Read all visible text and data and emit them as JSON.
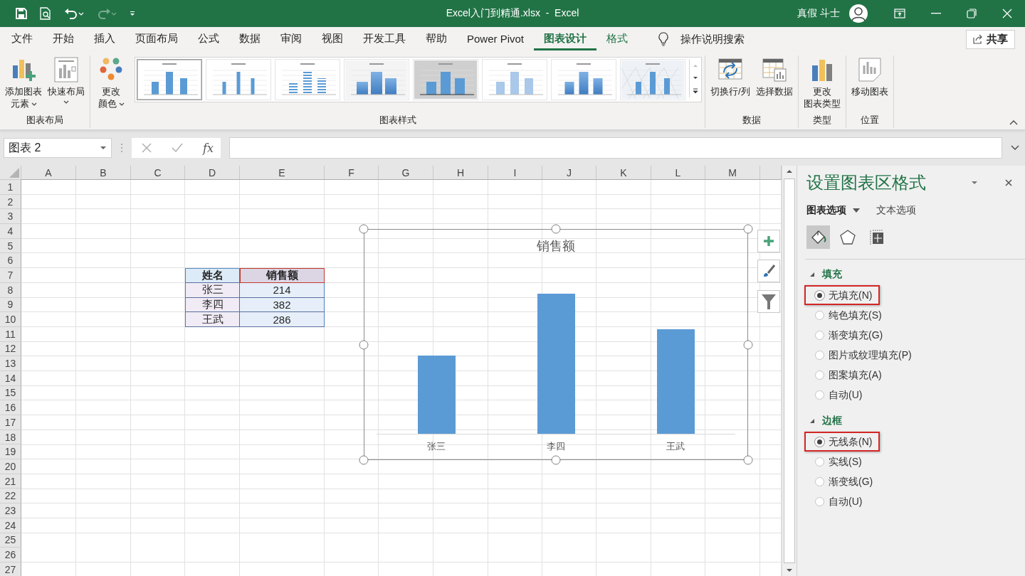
{
  "window": {
    "title": "Excel入门到精通.xlsx  -  Excel",
    "user": "真假 斗士"
  },
  "quick_access": [
    {
      "kind": "save",
      "disabled": false
    },
    {
      "kind": "preview",
      "disabled": false
    },
    {
      "kind": "undo",
      "disabled": false
    },
    {
      "kind": "redo",
      "disabled": true
    },
    {
      "kind": "customize",
      "disabled": false
    }
  ],
  "tabs": [
    {
      "label": "文件",
      "selected": false,
      "contextual": false
    },
    {
      "label": "开始",
      "selected": false,
      "contextual": false
    },
    {
      "label": "插入",
      "selected": false,
      "contextual": false
    },
    {
      "label": "页面布局",
      "selected": false,
      "contextual": false
    },
    {
      "label": "公式",
      "selected": false,
      "contextual": false
    },
    {
      "label": "数据",
      "selected": false,
      "contextual": false
    },
    {
      "label": "审阅",
      "selected": false,
      "contextual": false
    },
    {
      "label": "视图",
      "selected": false,
      "contextual": false
    },
    {
      "label": "开发工具",
      "selected": false,
      "contextual": false
    },
    {
      "label": "帮助",
      "selected": false,
      "contextual": false
    },
    {
      "label": "Power Pivot",
      "selected": false,
      "contextual": false
    },
    {
      "label": "图表设计",
      "selected": true,
      "contextual": true
    },
    {
      "label": "格式",
      "selected": false,
      "contextual": true
    }
  ],
  "tell_me": "操作说明搜索",
  "share": "共享",
  "ribbon": {
    "groups": [
      {
        "label": "图表布局",
        "buttons": [
          {
            "label": "添加图表元素",
            "kind": "add-element",
            "dropdown": true
          },
          {
            "label": "快速布局",
            "kind": "quick-layout",
            "dropdown": true
          }
        ]
      },
      {
        "label": "图表样式",
        "buttons": [
          {
            "label": "更改颜色",
            "kind": "colors",
            "dropdown": true
          }
        ],
        "styles": [
          {
            "kind": "plain",
            "selected": true
          },
          {
            "kind": "thin",
            "selected": false
          },
          {
            "kind": "striped",
            "selected": false
          },
          {
            "kind": "gradient",
            "selected": false
          },
          {
            "kind": "dark",
            "selected": false
          },
          {
            "kind": "light",
            "selected": false
          },
          {
            "kind": "shaded",
            "selected": false
          },
          {
            "kind": "hatched",
            "selected": false
          }
        ]
      },
      {
        "label": "数据",
        "buttons": [
          {
            "label": "切换行/列",
            "kind": "switch",
            "dropdown": false
          },
          {
            "label": "选择数据",
            "kind": "select-data",
            "dropdown": false
          }
        ]
      },
      {
        "label": "类型",
        "buttons": [
          {
            "label": "更改图表类型",
            "kind": "change-type",
            "dropdown": false
          }
        ]
      },
      {
        "label": "位置",
        "buttons": [
          {
            "label": "移动图表",
            "kind": "move",
            "dropdown": false
          }
        ]
      }
    ]
  },
  "formula_bar": {
    "name_box": "图表 2",
    "function_label": "fx"
  },
  "sheet": {
    "columns": [
      "A",
      "B",
      "C",
      "D",
      "E",
      "F",
      "G",
      "H",
      "I",
      "J",
      "K",
      "L",
      "M"
    ],
    "rows": [
      "1",
      "2",
      "3",
      "4",
      "5",
      "6",
      "7",
      "8",
      "9",
      "10",
      "11",
      "12",
      "13",
      "14",
      "15",
      "16",
      "17",
      "18",
      "19",
      "20",
      "21",
      "22",
      "23",
      "24",
      "25",
      "26",
      "27"
    ],
    "table": {
      "header": [
        "姓名",
        "销售额"
      ],
      "rows": [
        [
          "张三",
          "214"
        ],
        [
          "李四",
          "382"
        ],
        [
          "王武",
          "286"
        ]
      ]
    }
  },
  "chart": {
    "title": "销售额",
    "categories": [
      "张三",
      "李四",
      "王武"
    ]
  },
  "panel": {
    "title": "设置图表区格式",
    "tabs": [
      {
        "label": "图表选项",
        "selected": true,
        "dropdown": true
      },
      {
        "label": "文本选项",
        "selected": false,
        "dropdown": false
      }
    ],
    "icon_tabs": [
      {
        "kind": "fill",
        "selected": true
      },
      {
        "kind": "effects",
        "selected": false
      },
      {
        "kind": "size",
        "selected": false
      }
    ],
    "sections": [
      {
        "title": "填充",
        "expanded": true,
        "options": [
          {
            "label": "无填充(N)",
            "selected": true,
            "annotated": true
          },
          {
            "label": "纯色填充(S)",
            "selected": false,
            "annotated": false
          },
          {
            "label": "渐变填充(G)",
            "selected": false,
            "annotated": false
          },
          {
            "label": "图片或纹理填充(P)",
            "selected": false,
            "annotated": false
          },
          {
            "label": "图案填充(A)",
            "selected": false,
            "annotated": false
          },
          {
            "label": "自动(U)",
            "selected": false,
            "annotated": false
          }
        ]
      },
      {
        "title": "边框",
        "expanded": true,
        "options": [
          {
            "label": "无线条(N)",
            "selected": true,
            "annotated": true
          },
          {
            "label": "实线(S)",
            "selected": false,
            "annotated": false
          },
          {
            "label": "渐变线(G)",
            "selected": false,
            "annotated": false
          },
          {
            "label": "自动(U)",
            "selected": false,
            "annotated": false
          }
        ]
      }
    ]
  }
}
